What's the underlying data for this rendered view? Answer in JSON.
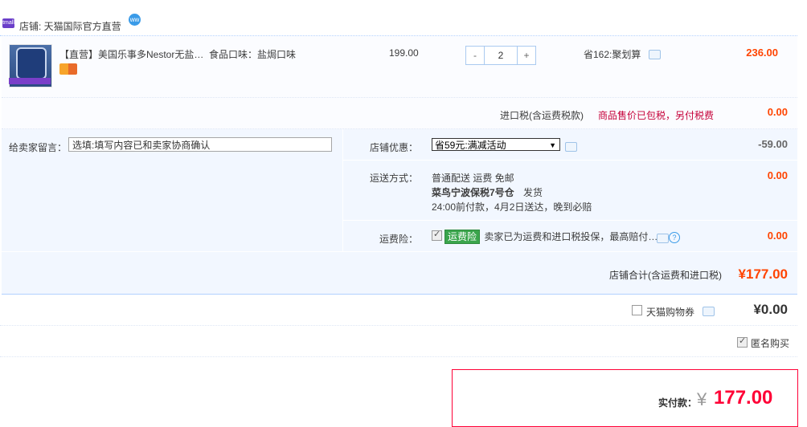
{
  "shop": {
    "label": "店铺: 天猫国际官方直营",
    "logo_icon": "tmall-logo-icon",
    "ww_icon": "wangwang-icon",
    "logo_text": "tmall",
    "ww_text": "ww"
  },
  "item": {
    "title": "【直营】美国乐事多Nestor无盐…",
    "sku": "食品口味：盐焗口味",
    "price": "199.00",
    "qty_minus": "-",
    "qty": "2",
    "qty_plus": "+",
    "promo": "省162:聚划算",
    "subtotal": "236.00"
  },
  "tax": {
    "label": "进口税(含运费税款)",
    "note": "商品售价已包税，另付税费",
    "value": "0.00"
  },
  "memo": {
    "label": "给卖家留言：",
    "placeholder": "选填:填写内容已和卖家协商确认"
  },
  "discount": {
    "label": "店铺优惠：",
    "selected": "省59元:满减活动",
    "arrow": "▼",
    "value": "-59.00"
  },
  "shipping": {
    "label": "运送方式：",
    "method": "普通配送 运费 免邮",
    "warehouse": "菜鸟宁波保税7号仓",
    "dispatch": "发货",
    "eta": "24:00前付款，4月2日送达，晚到必赔",
    "value": "0.00"
  },
  "insurance": {
    "label": "运费险：",
    "tag": "运费险",
    "text": "卖家已为运费和进口税投保，最高赔付…",
    "help": "?",
    "value": "0.00"
  },
  "shop_total": {
    "label": "店铺合计(含运费和进口税)",
    "value": "¥177.00"
  },
  "coupon": {
    "label": "天猫购物券",
    "value": "¥0.00"
  },
  "anonymous": {
    "label": "匿名购买",
    "checked": true
  },
  "payment": {
    "label": "实付款：",
    "yen": "¥",
    "value": "177.00"
  }
}
